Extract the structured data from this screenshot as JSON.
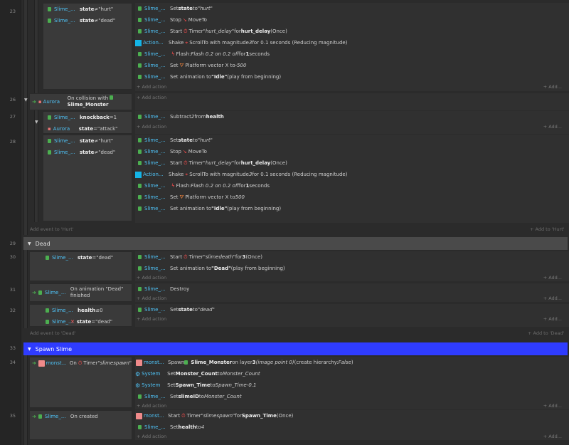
{
  "line_numbers": [
    "23",
    "26",
    "27",
    "28",
    "29",
    "30",
    "31",
    "32",
    "33",
    "34",
    "35"
  ],
  "labels": {
    "slime": "Slime_...",
    "action": "Action...",
    "monst": "monst...",
    "system": "System",
    "aurora": "Aurora",
    "add_action": "Add action",
    "add": "Add...",
    "add_event_hurt": "Add event to 'Hurt'",
    "add_to_hurt": "Add to 'Hurt'",
    "add_event_dead": "Add event to 'Dead'",
    "add_to_dead": "Add to 'Dead'"
  },
  "block23": {
    "cond1": {
      "field": "state",
      "op": " ≠ ",
      "value": "\"hurt\""
    },
    "cond2": {
      "field": "state",
      "op": " ≠ ",
      "value": "\"dead\""
    },
    "a1": {
      "pre": "Set ",
      "b": "state",
      "mid": " to ",
      "it": "\"hurt\""
    },
    "a2": {
      "pre": "Stop ",
      "post": "MoveTo"
    },
    "a3": {
      "pre": "Start ",
      "mid": "Timer ",
      "it": "\"hurt_delay\"",
      "mid2": " for ",
      "b": "hurt_delay",
      "post": " (Once)"
    },
    "a4": {
      "pre": "Shake ",
      "post": "ScrollTo with magnitude ",
      "it": "3",
      "post2": " for 0.1 seconds (Reducing magnitude)"
    },
    "a5": {
      "pre": "Flash: ",
      "it": "Flash 0.2 on 0.2 off",
      "mid": " for ",
      "b": "1",
      "post": " seconds"
    },
    "a6": {
      "pre": "Set ",
      "post": "Platform vector X to ",
      "it": "-500"
    },
    "a7": {
      "pre": "Set animation to ",
      "b": "\"Idle\"",
      "post": " (play from beginning)"
    }
  },
  "block26": {
    "event_pre": "On collision with",
    "event_obj": "Slime_Monster"
  },
  "block27": {
    "cond1": {
      "field": "knockback",
      "op": " = ",
      "value": "1"
    },
    "cond2": {
      "field": "state",
      "op": " = ",
      "value": "\"attack\""
    },
    "a1": {
      "pre": "Subtract ",
      "it": "2",
      "mid": " from ",
      "b": "health"
    }
  },
  "block28": {
    "cond1": {
      "field": "state",
      "op": " ≠ ",
      "value": "\"hurt\""
    },
    "cond2": {
      "field": "state",
      "op": " ≠ ",
      "value": "\"dead\""
    },
    "a1": {
      "pre": "Set ",
      "b": "state",
      "mid": " to ",
      "it": "\"hurt\""
    },
    "a2": {
      "pre": "Stop ",
      "post": "MoveTo"
    },
    "a3": {
      "pre": "Start ",
      "mid": "Timer ",
      "it": "\"hurt_delay\"",
      "mid2": " for ",
      "b": "hurt_delay",
      "post": " (Once)"
    },
    "a4": {
      "pre": "Shake ",
      "post": "ScrollTo with magnitude ",
      "it": "3",
      "post2": " for 0.1 seconds (Reducing magnitude)"
    },
    "a5": {
      "pre": "Flash: ",
      "it": "Flash 0.2 on 0.2 off",
      "mid": " for ",
      "b": "1",
      "post": " seconds"
    },
    "a6": {
      "pre": "Set ",
      "post": "Platform vector X to ",
      "it": "500"
    },
    "a7": {
      "pre": "Set animation to ",
      "b": "\"Idle\"",
      "post": " (play from beginning)"
    }
  },
  "group_dead": {
    "title": "Dead"
  },
  "block30": {
    "cond1": {
      "field": "state",
      "op": " = ",
      "value": "\"dead\""
    },
    "a1": {
      "pre": "Start ",
      "mid": "Timer ",
      "it": "\"slimedeath\"",
      "mid2": " for ",
      "b": "3",
      "post": " (Once)"
    },
    "a2": {
      "pre": "Set animation to ",
      "b": "\"Dead\"",
      "post": " (play from beginning)"
    }
  },
  "block31": {
    "event": "On animation \"Dead\"",
    "event2": "finished",
    "a1": "Destroy"
  },
  "block32": {
    "cond1": {
      "field": "health",
      "op": " ≤ ",
      "value": "0"
    },
    "cond2": {
      "field": "state",
      "op": " = ",
      "value": "\"dead\""
    },
    "a1": {
      "pre": "Set ",
      "b": "state",
      "mid": " to ",
      "it": "\"dead\""
    }
  },
  "group_spawn": {
    "title": "Spawn Slime"
  },
  "block34": {
    "event_pre": "On ",
    "event_mid": "Timer ",
    "event_it": "\"slimespawn\"",
    "a1": {
      "pre": "Spawn ",
      "obj": "Slime_Monster",
      "mid": " on layer ",
      "b": "3",
      "it": " (image point 0)",
      "post": " (create hierarchy: ",
      "it2": "False",
      "post2": ")"
    },
    "a2": {
      "pre": "Set ",
      "b": "Monster_Count",
      "mid": " to ",
      "it": "Monster_Count"
    },
    "a3": {
      "pre": "Set ",
      "b": "Spawn_Time",
      "mid": " to ",
      "it": "Spawn_Time-0.1"
    },
    "a4": {
      "pre": "Set ",
      "b": "slimeID",
      "mid": " to ",
      "it": "Monster_Count"
    }
  },
  "block35": {
    "event": "On created",
    "a1": {
      "pre": "Start ",
      "mid": "Timer ",
      "it": "\"slimespawn\"",
      "mid2": " for ",
      "b": "Spawn_Time",
      "post": " (Once)"
    },
    "a2": {
      "pre": "Set ",
      "b": "health",
      "mid": " to ",
      "it": "4"
    }
  },
  "colors": {
    "bg": "#2b2b2b",
    "accent_cyan": "#4fc3f7",
    "spawn_group": "#2f3cff",
    "object_green": "#4caf50",
    "monster_pink": "#f08a8a"
  }
}
